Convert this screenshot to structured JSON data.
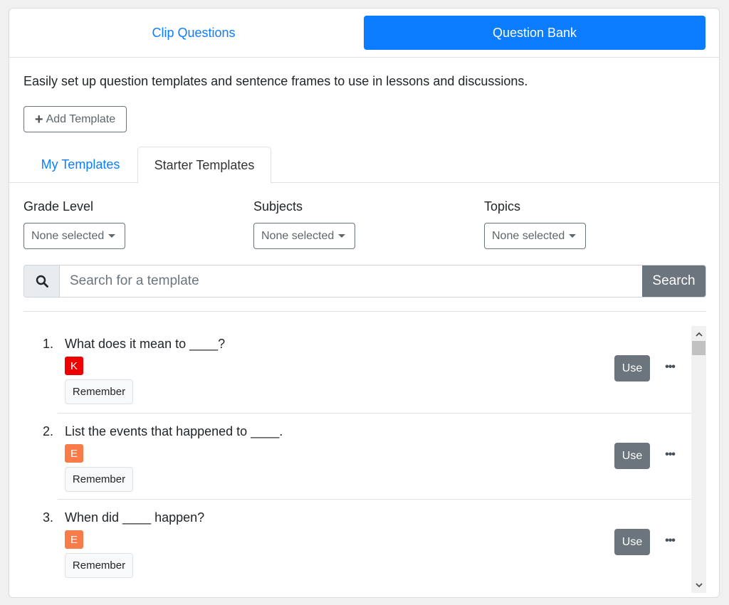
{
  "top_tabs": [
    {
      "label": "Clip Questions",
      "active": false
    },
    {
      "label": "Question Bank",
      "active": true
    }
  ],
  "intro_text": "Easily set up question templates and sentence frames to use in lessons and discussions.",
  "add_template_label": "Add Template",
  "sub_tabs": [
    {
      "label": "My Templates",
      "active": false
    },
    {
      "label": "Starter Templates",
      "active": true
    }
  ],
  "filters": [
    {
      "label": "Grade Level",
      "value": "None selected"
    },
    {
      "label": "Subjects",
      "value": "None selected"
    },
    {
      "label": "Topics",
      "value": "None selected"
    }
  ],
  "search": {
    "placeholder": "Search for a template",
    "button_label": "Search",
    "icon": "search-icon"
  },
  "templates": [
    {
      "number": "1.",
      "title": "What does it mean to ____?",
      "level": "K",
      "level_color": "#ee0000",
      "tag": "Remember",
      "use_label": "Use"
    },
    {
      "number": "2.",
      "title": "List the events that happened to ____.",
      "level": "E",
      "level_color": "#f87b49",
      "tag": "Remember",
      "use_label": "Use"
    },
    {
      "number": "3.",
      "title": "When did ____ happen?",
      "level": "E",
      "level_color": "#f87b49",
      "tag": "Remember",
      "use_label": "Use"
    }
  ],
  "colors": {
    "primary": "#0b7bff",
    "secondary": "#6c757d"
  }
}
